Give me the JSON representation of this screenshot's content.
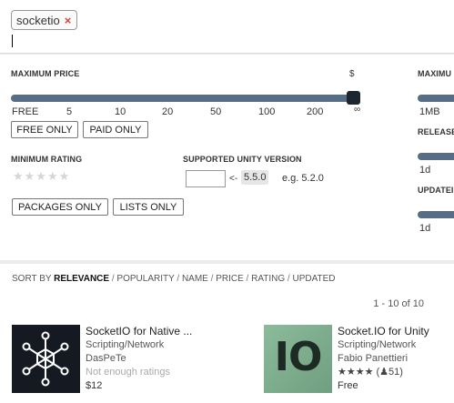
{
  "search": {
    "tag_label": "socketio",
    "tag_remove": "×"
  },
  "filters": {
    "max_price_label": "MAXIMUM PRICE",
    "currency_symbol": "$",
    "price_ticks": [
      "FREE",
      "5",
      "10",
      "20",
      "50",
      "100",
      "200",
      "∞"
    ],
    "price_level": 1.0,
    "free_only_label": "FREE ONLY",
    "paid_only_label": "PAID ONLY",
    "min_rating_label": "MINIMUM RATING",
    "rating_stars": "★★★★★",
    "unity_version_label": "SUPPORTED UNITY VERSION",
    "unity_arrow": "<-",
    "unity_version_value": "5.5.0",
    "unity_example": "e.g. 5.2.0",
    "packages_only_label": "PACKAGES ONLY",
    "lists_only_label": "LISTS ONLY",
    "max_size_label": "MAXIMU",
    "size_tick": "1MB",
    "released_label": "RELEASE",
    "released_tick": "1d",
    "updated_label": "UPDATEI",
    "updated_tick": "1d"
  },
  "results": {
    "sort_prefix": "SORT BY",
    "sort_options": [
      "RELEVANCE",
      "POPULARITY",
      "NAME",
      "PRICE",
      "RATING",
      "UPDATED"
    ],
    "sort_separator": "/",
    "active_sort": "RELEVANCE",
    "count_text": "1 - 10 of 10",
    "items": [
      {
        "title": "SocketIO for Native ...",
        "category": "Scripting/Network",
        "publisher": "DasPeTe",
        "rating_text": "Not enough ratings",
        "price": "$12"
      },
      {
        "title": "Socket.IO for Unity",
        "category": "Scripting/Network",
        "publisher": "Fabio Panettieri",
        "stars": "★★★★",
        "rating_count": "(♟51)",
        "price": "Free",
        "thumb_text": "IO"
      }
    ]
  },
  "colors": {
    "slider": "#566d83",
    "handle": "#1c2631",
    "remove": "#d9403b",
    "io_thumb": "#7fae8f"
  }
}
